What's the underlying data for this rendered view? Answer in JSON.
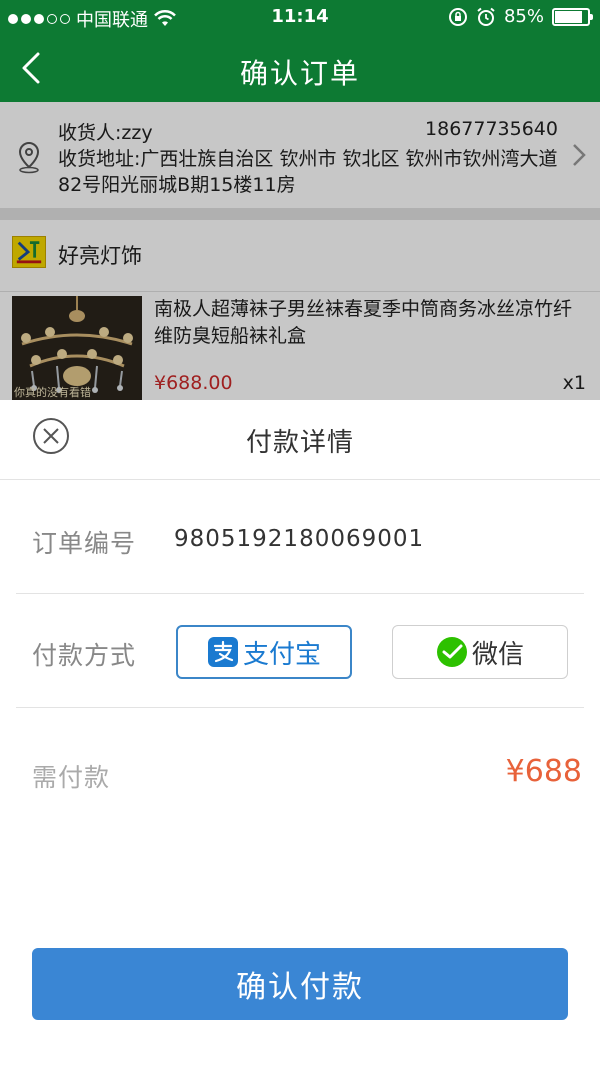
{
  "status_bar": {
    "carrier": "中国联通",
    "time": "11:14",
    "battery_percent": "85%",
    "battery_level": 0.85
  },
  "nav": {
    "title": "确认订单"
  },
  "address": {
    "recipient": "收货人:zzy",
    "phone": "18677735640",
    "address": "收货地址:广西壮族自治区 钦州市 钦北区 钦州市钦州湾大道82号阳光丽城B期15楼11房"
  },
  "shop": {
    "name": "好亮灯饰"
  },
  "product": {
    "title": "南极人超薄袜子男丝袜春夏季中筒商务冰丝凉竹纤维防臭短船袜礼盒",
    "price": "¥688.00",
    "quantity": "x1",
    "thumb_caption": "你真的没有看错"
  },
  "payment": {
    "title": "付款详情",
    "order_label": "订单编号",
    "order_number": "9805192180069001",
    "method_label": "付款方式",
    "alipay_label": "支付宝",
    "wechat_label": "微信",
    "due_label": "需付款",
    "due_amount": "¥688",
    "confirm_label": "确认付款"
  },
  "colors": {
    "header_green": "#0d7a33",
    "confirm_blue": "#3a86d4",
    "price_red": "#cc2a2a",
    "due_orange": "#e8623a",
    "alipay_blue": "#1a7ad0",
    "wechat_green": "#2dc100"
  }
}
